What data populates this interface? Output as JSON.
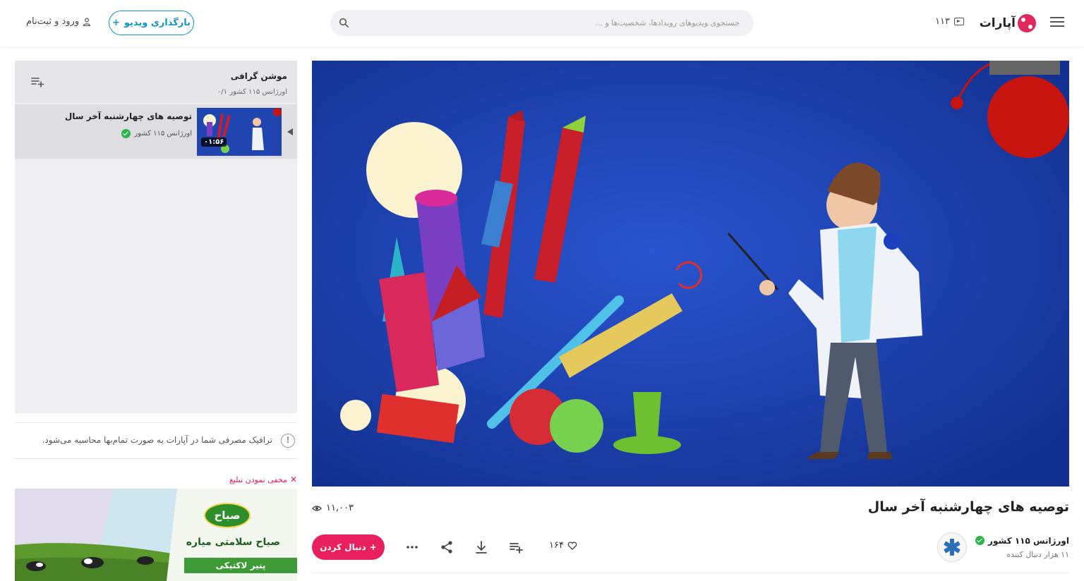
{
  "header": {
    "logo_text": "آپارات",
    "live_count": "۱۱۳",
    "search_placeholder": "جستجوی ویدیوهای رویدادها، شخصیت‌ها و ...",
    "upload_label": "بارگذاری ویدیو",
    "login_label": "ورود و ثبت‌نام"
  },
  "video": {
    "title": "توصیه های چهارشنبه آخر سال",
    "views": "۱۱,۰۰۳",
    "likes": "۱۶۴",
    "follow_label": "دنبال کردن",
    "channel_name": "اورژانس ۱۱۵ کشور",
    "channel_followers": "۱۱ هزار دنبال کننده",
    "actions": [
      "like-icon",
      "add-to-playlist-icon",
      "download-icon",
      "share-icon",
      "more-icon"
    ]
  },
  "playlist": {
    "title": "موشن گرافی",
    "subtitle": "اورژانس ۱۱۵ کشور ۰/۱",
    "items": [
      {
        "title": "توصیه های چهارشنبه آخر سال",
        "channel": "اورژانس ۱۱۵ کشور",
        "duration": "۰۱:۵۶"
      }
    ]
  },
  "notice": {
    "traffic_text": "ترافیک مصرفی شما در آپارات به صورت تمام‌بها محاسبه می‌شود."
  },
  "ad": {
    "hide_label": "مخفی نمودن تبلیغ",
    "brand": "صباح",
    "slogan": "صباح سلامتی میاره",
    "product": "پنیر لاکتیکی"
  },
  "colors": {
    "accent_pink": "#e8205e",
    "accent_blue": "#0d96c9",
    "player_bg": "#1a3fa8"
  }
}
